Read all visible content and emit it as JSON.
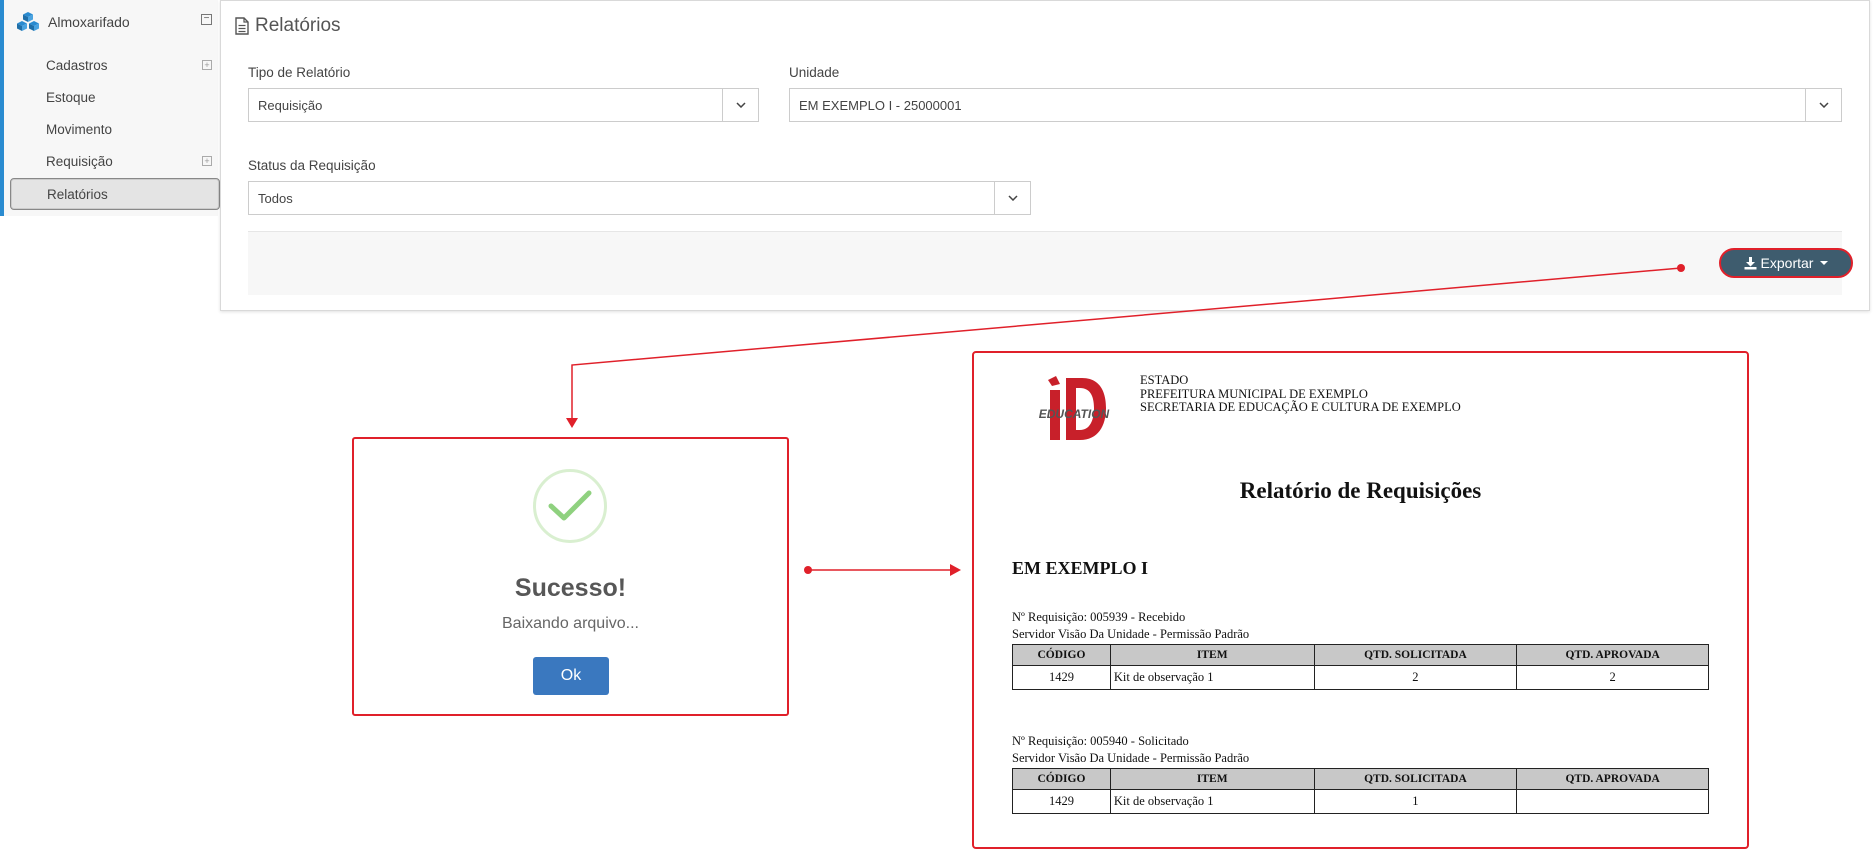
{
  "sidebar": {
    "module_label": "Almoxarifado",
    "module_toggle": "−",
    "items": [
      {
        "label": "Cadastros",
        "expandable": true
      },
      {
        "label": "Estoque",
        "expandable": false
      },
      {
        "label": "Movimento",
        "expandable": false
      },
      {
        "label": "Requisição",
        "expandable": true
      },
      {
        "label": "Relatórios",
        "expandable": false,
        "active": true
      }
    ],
    "expand_glyph": "+"
  },
  "panel": {
    "title": "Relatórios",
    "report_type_label": "Tipo de Relatório",
    "report_type_value": "Requisição",
    "unit_label": "Unidade",
    "unit_value": "EM EXEMPLO I - 25000001",
    "status_label": "Status da Requisição",
    "status_value": "Todos",
    "export_label": "Exportar"
  },
  "success_dialog": {
    "title": "Sucesso!",
    "message": "Baixando arquivo...",
    "ok_label": "Ok"
  },
  "report": {
    "logo_text": "EDUCATION",
    "header_lines": [
      "ESTADO",
      "PREFEITURA MUNICIPAL DE EXEMPLO",
      "SECRETARIA DE EDUCAÇÃO E CULTURA DE EXEMPLO"
    ],
    "title": "Relatório de Requisições",
    "unit": "EM EXEMPLO I",
    "columns": [
      "CÓDIGO",
      "ITEM",
      "QTD. SOLICITADA",
      "QTD. APROVADA"
    ],
    "requisitions": [
      {
        "number_line": "Nº Requisição: 005939 - Recebido",
        "server_line": "Servidor Visão Da Unidade - Permissão Padrão",
        "rows": [
          {
            "code": "1429",
            "item": "Kit de observação 1",
            "requested": "2",
            "approved": "2"
          }
        ]
      },
      {
        "number_line": "Nº Requisição: 005940 - Solicitado",
        "server_line": "Servidor Visão Da Unidade - Permissão Padrão",
        "rows": [
          {
            "code": "1429",
            "item": "Kit de observação 1",
            "requested": "1",
            "approved": ""
          }
        ]
      }
    ]
  },
  "colors": {
    "accent_blue": "#2a8bd0",
    "annotation_red": "#e0202a",
    "export_button": "#3e5c6e",
    "ok_button": "#3a78bf",
    "success_check": "#8fd17f"
  },
  "icons": {
    "module": "cubes-icon",
    "panel_title": "file-text-icon",
    "export": "download-icon",
    "dropdown": "chevron-down-icon",
    "success": "check-icon"
  }
}
